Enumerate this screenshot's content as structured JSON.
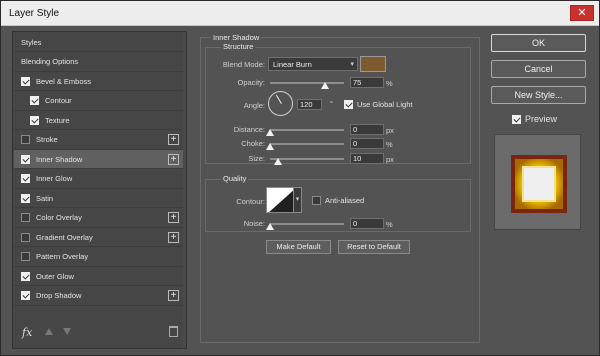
{
  "window": {
    "title": "Layer Style",
    "close_glyph": "✕"
  },
  "sidebar": {
    "items": [
      {
        "label": "Styles",
        "header": true
      },
      {
        "label": "Blending Options",
        "header": true
      },
      {
        "label": "Bevel & Emboss",
        "checked": true
      },
      {
        "label": "Contour",
        "checked": true,
        "sub": true
      },
      {
        "label": "Texture",
        "checked": true,
        "sub": true
      },
      {
        "label": "Stroke",
        "checked": false,
        "plus": true
      },
      {
        "label": "Inner Shadow",
        "checked": true,
        "plus": true,
        "selected": true
      },
      {
        "label": "Inner Glow",
        "checked": true
      },
      {
        "label": "Satin",
        "checked": true
      },
      {
        "label": "Color Overlay",
        "checked": false,
        "plus": true
      },
      {
        "label": "Gradient Overlay",
        "checked": false,
        "plus": true
      },
      {
        "label": "Pattern Overlay",
        "checked": false
      },
      {
        "label": "Outer Glow",
        "checked": true
      },
      {
        "label": "Drop Shadow",
        "checked": true,
        "plus": true
      }
    ],
    "plus_glyph": "+",
    "fx_label": "fx"
  },
  "inner_shadow": {
    "section_title": "Inner Shadow",
    "structure_title": "Structure",
    "blend_mode_label": "Blend Mode:",
    "blend_mode_value": "Linear Burn",
    "shadow_color": "#7d5b2f",
    "opacity_label": "Opacity:",
    "opacity_value": "75",
    "opacity_unit": "%",
    "angle_label": "Angle:",
    "angle_value": "120",
    "angle_unit": "°",
    "use_global_light_label": "Use Global Light",
    "use_global_light": true,
    "distance_label": "Distance:",
    "distance_value": "0",
    "distance_unit": "px",
    "choke_label": "Choke:",
    "choke_value": "0",
    "choke_unit": "%",
    "size_label": "Size:",
    "size_value": "10",
    "size_unit": "px"
  },
  "quality": {
    "title": "Quality",
    "contour_label": "Contour:",
    "anti_aliased_label": "Anti-aliased",
    "anti_aliased": false,
    "noise_label": "Noise:",
    "noise_value": "0",
    "noise_unit": "%"
  },
  "buttons": {
    "make_default": "Make Default",
    "reset_default": "Reset to Default",
    "ok": "OK",
    "cancel": "Cancel",
    "new_style": "New Style...",
    "preview_label": "Preview",
    "preview_checked": true
  }
}
